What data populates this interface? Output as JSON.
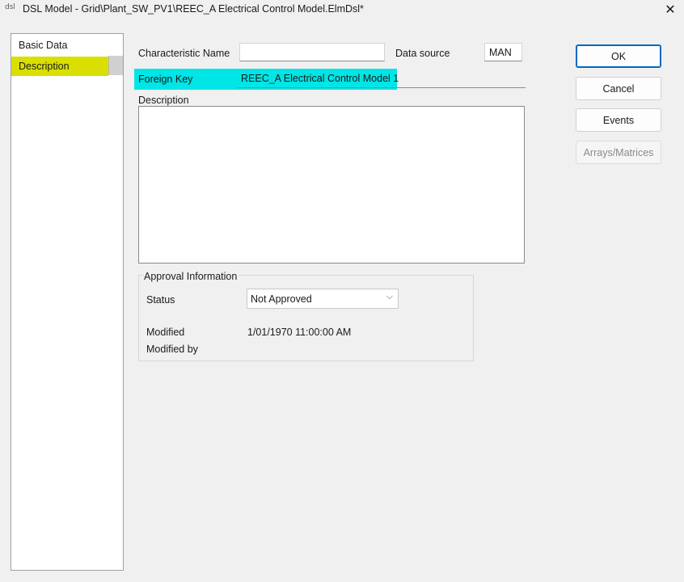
{
  "window": {
    "app_icon": "dsl",
    "title": "DSL Model - Grid\\Plant_SW_PV1\\REEC_A Electrical Control Model.ElmDsl*",
    "close_glyph": "✕"
  },
  "nav": {
    "items": [
      {
        "label": "Basic Data",
        "selected": false
      },
      {
        "label": "Description",
        "selected": true
      }
    ]
  },
  "form": {
    "characteristic_name_label": "Characteristic Name",
    "characteristic_name_value": "",
    "data_source_label": "Data source",
    "data_source_value": "MAN",
    "foreign_key_label": "Foreign Key",
    "foreign_key_value": "REEC_A Electrical Control Model 1",
    "description_label": "Description",
    "description_value": ""
  },
  "approval": {
    "group_title": "Approval Information",
    "status_label": "Status",
    "status_value": "Not Approved",
    "modified_label": "Modified",
    "modified_value": "1/01/1970 11:00:00 AM",
    "modified_by_label": "Modified by",
    "modified_by_value": ""
  },
  "buttons": {
    "ok": "OK",
    "cancel": "Cancel",
    "events": "Events",
    "arrays_matrices": "Arrays/Matrices"
  },
  "colors": {
    "nav_selected": "#d9df00",
    "foreign_key_highlight": "#00e5e5",
    "primary_button_border": "#0067c0"
  },
  "icons": {
    "app": "dsl-app-icon",
    "close": "close-icon",
    "dropdown": "chevron-down-icon"
  }
}
